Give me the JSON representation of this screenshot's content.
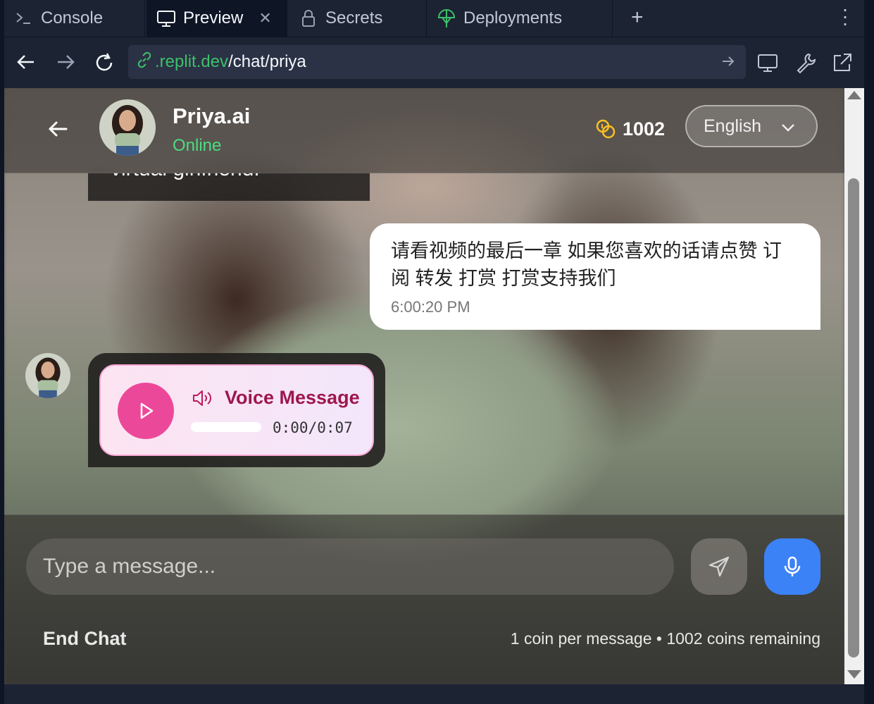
{
  "ide": {
    "tabs": [
      {
        "label": "Console",
        "icon": "terminal-icon",
        "active": false
      },
      {
        "label": "Preview",
        "icon": "monitor-icon",
        "active": true
      },
      {
        "label": "Secrets",
        "icon": "lock-icon",
        "active": false
      },
      {
        "label": "Deployments",
        "icon": "deploy-icon",
        "active": false
      }
    ],
    "url": {
      "domain": ".replit.dev",
      "path": "/chat/priya"
    }
  },
  "chat": {
    "header": {
      "name": "Priya.ai",
      "status": "Online",
      "coins": "1002",
      "language": "English"
    },
    "messages": {
      "previous_partial": "virtual girlfriend.",
      "user_text": "请看视频的最后一章 如果您喜欢的话请点赞 订阅 转发 打赏 打赏支持我们",
      "user_time": "6:00:20 PM",
      "voice_title": "Voice Message",
      "voice_time": "0:00/0:07",
      "voice_progress": 0
    },
    "footer": {
      "placeholder": "Type a message...",
      "end_chat": "End Chat",
      "coin_info": "1 coin per message • 1002 coins remaining"
    }
  },
  "colors": {
    "online": "#4ade80",
    "accent_pink": "#ec4899",
    "mic_blue": "#3b82f6",
    "coin_gold": "#fbbf24"
  }
}
